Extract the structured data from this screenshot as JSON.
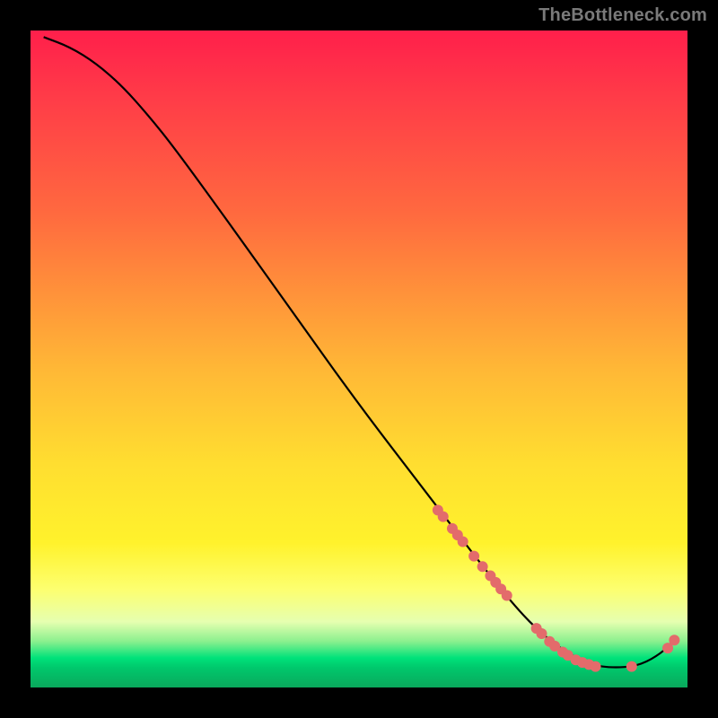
{
  "attribution": "TheBottleneck.com",
  "chart_data": {
    "type": "line",
    "title": "",
    "xlabel": "",
    "ylabel": "",
    "xlim": [
      0,
      100
    ],
    "ylim": [
      0,
      100
    ],
    "grid": false,
    "curve": [
      {
        "x": 2,
        "y": 99
      },
      {
        "x": 6,
        "y": 97.5
      },
      {
        "x": 10,
        "y": 95
      },
      {
        "x": 14,
        "y": 91.5
      },
      {
        "x": 18,
        "y": 87
      },
      {
        "x": 22,
        "y": 82
      },
      {
        "x": 30,
        "y": 71
      },
      {
        "x": 40,
        "y": 57
      },
      {
        "x": 50,
        "y": 43
      },
      {
        "x": 60,
        "y": 30
      },
      {
        "x": 68,
        "y": 19.5
      },
      {
        "x": 74,
        "y": 12
      },
      {
        "x": 78,
        "y": 8
      },
      {
        "x": 82,
        "y": 5
      },
      {
        "x": 86,
        "y": 3.2
      },
      {
        "x": 90,
        "y": 3
      },
      {
        "x": 93,
        "y": 3.5
      },
      {
        "x": 96,
        "y": 5.2
      },
      {
        "x": 98,
        "y": 7.2
      }
    ],
    "markers": [
      {
        "x": 62,
        "y": 27
      },
      {
        "x": 62.8,
        "y": 26
      },
      {
        "x": 64.2,
        "y": 24.2
      },
      {
        "x": 65,
        "y": 23.2
      },
      {
        "x": 65.8,
        "y": 22.2
      },
      {
        "x": 67.5,
        "y": 20
      },
      {
        "x": 68.8,
        "y": 18.4
      },
      {
        "x": 70,
        "y": 17
      },
      {
        "x": 70.8,
        "y": 16
      },
      {
        "x": 71.6,
        "y": 15
      },
      {
        "x": 72.5,
        "y": 14
      },
      {
        "x": 77,
        "y": 9
      },
      {
        "x": 77.8,
        "y": 8.2
      },
      {
        "x": 79,
        "y": 7
      },
      {
        "x": 79.8,
        "y": 6.3
      },
      {
        "x": 81,
        "y": 5.4
      },
      {
        "x": 81.8,
        "y": 4.9
      },
      {
        "x": 83,
        "y": 4.2
      },
      {
        "x": 84,
        "y": 3.8
      },
      {
        "x": 85,
        "y": 3.5
      },
      {
        "x": 86,
        "y": 3.2
      },
      {
        "x": 91.5,
        "y": 3.2
      },
      {
        "x": 97,
        "y": 6
      },
      {
        "x": 98,
        "y": 7.2
      }
    ],
    "curve_color": "#000000",
    "marker_color": "#e36b6b",
    "marker_radius_px": 6
  }
}
